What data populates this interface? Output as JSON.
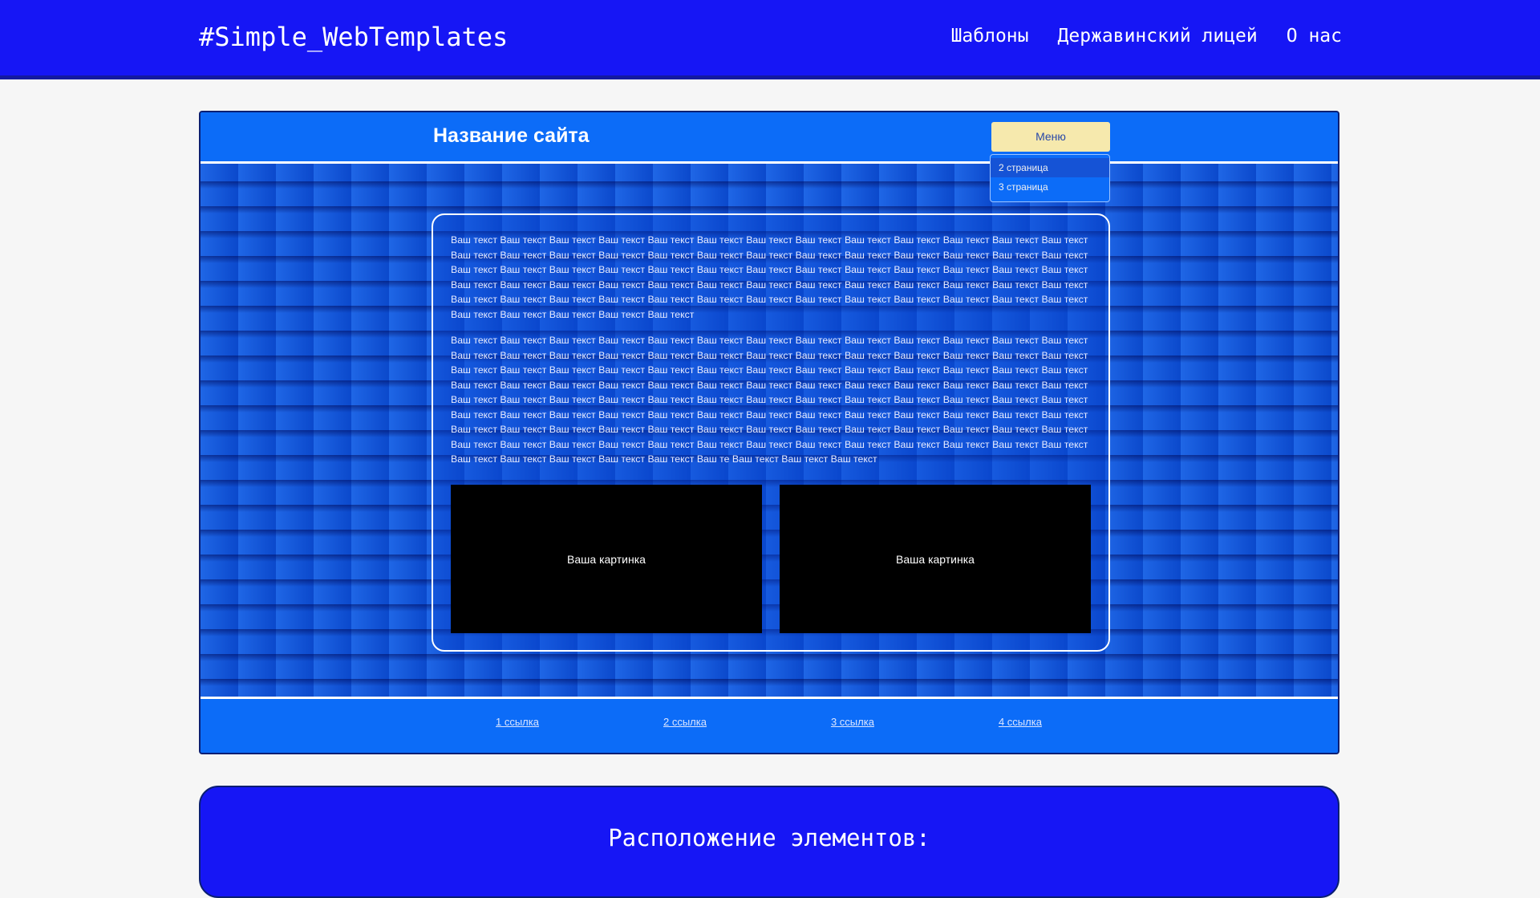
{
  "header": {
    "brand": "#Simple_WebTemplates",
    "nav": [
      "Шаблоны",
      "Державинский лицей",
      "О нас"
    ]
  },
  "demo": {
    "site_name": "Название сайта",
    "menu_label": "Меню",
    "dropdown_items": [
      "2 страница",
      "3 страница"
    ],
    "paragraph_1": "Ваш текст Ваш текст Ваш текст Ваш текст Ваш текст Ваш текст Ваш текст Ваш текст Ваш текст Ваш текст Ваш текст Ваш текст Ваш текст Ваш текст Ваш текст Ваш текст Ваш текст Ваш текст Ваш текст Ваш текст Ваш текст Ваш текст Ваш текст Ваш текст Ваш текст Ваш текст Ваш текст Ваш текст Ваш текст Ваш текст Ваш текст Ваш текст Ваш текст Ваш текст Ваш текст Ваш текст Ваш текст Ваш текст Ваш текст Ваш текст Ваш текст Ваш текст Ваш текст Ваш текст Ваш текст Ваш текст Ваш текст Ваш текст Ваш текст Ваш текст Ваш текст Ваш текст Ваш текст Ваш текст Ваш текст Ваш текст Ваш текст Ваш текст Ваш текст Ваш текст Ваш текст Ваш текст Ваш текст Ваш текст Ваш текст Ваш текст Ваш текст Ваш текст Ваш текст Ваш текст",
    "paragraph_2": "Ваш текст Ваш текст Ваш текст Ваш текст Ваш текст Ваш текст Ваш текст Ваш текст Ваш текст Ваш текст Ваш текст Ваш текст Ваш текст Ваш текст Ваш текст Ваш текст Ваш текст Ваш текст Ваш текст Ваш текст Ваш текст Ваш текст Ваш текст Ваш текст Ваш текст Ваш текст Ваш текст Ваш текст Ваш текст Ваш текст Ваш текст Ваш текст Ваш текст Ваш текст Ваш текст Ваш текст Ваш текст Ваш текст Ваш текст Ваш текст Ваш текст Ваш текст Ваш текст Ваш текст Ваш текст Ваш текст Ваш текст Ваш текст Ваш текст Ваш текст Ваш текст Ваш текст Ваш текст Ваш текст Ваш текст Ваш текст Ваш текст Ваш текст Ваш текст Ваш текст Ваш текст Ваш текст Ваш текст Ваш текст Ваш текст Ваш текст Ваш текст Ваш текст Ваш текст Ваш текст Ваш текст Ваш текст Ваш текст Ваш текст Ваш текст Ваш текст Ваш текст Ваш текст Ваш текст Ваш текст Ваш текст Ваш текст Ваш текст Ваш текст Ваш текст Ваш текст Ваш текст Ваш текст Ваш текст Ваш текст Ваш текст Ваш текст Ваш текст Ваш текст Ваш текст Ваш текст Ваш текст Ваш текст Ваш текст Ваш текст Ваш текст Ваш текст Ваш текст Ваш текст Ваш текст Ваш текст Ваш текст Ваш текст Ваш текст Ваш те Ваш текст Ваш текст Ваш текст",
    "picture_1": "Ваша картинка",
    "picture_2": "Ваша картинка",
    "footer_links": [
      "1 ссылка",
      "2 ссылка",
      "3 ссылка",
      "4 ссылка"
    ]
  },
  "section": {
    "title": "Расположение элементов:"
  }
}
